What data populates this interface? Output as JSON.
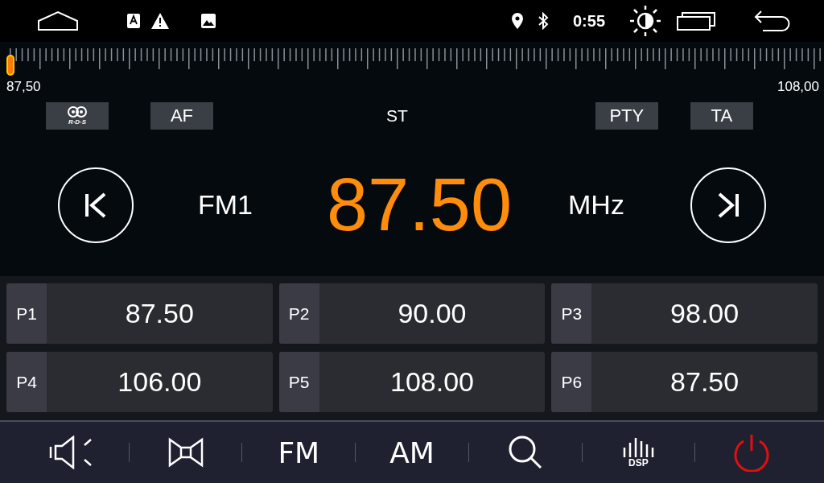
{
  "status_bar": {
    "time": "0:55"
  },
  "tuner": {
    "level": 0,
    "min_label": "87,50",
    "max_label": "108,00"
  },
  "indicators": [
    {
      "kind": "rds",
      "label": "R·D·S"
    },
    {
      "kind": "button",
      "label": "AF"
    },
    {
      "kind": "text",
      "label": "ST"
    },
    {
      "kind": "button",
      "label": "PTY"
    },
    {
      "kind": "button",
      "label": "TA"
    }
  ],
  "band": "FM1",
  "frequency": "87.50",
  "unit": "MHz",
  "presets": [
    {
      "label": "P1",
      "frequency": "87.50"
    },
    {
      "label": "P2",
      "frequency": "90.00"
    },
    {
      "label": "P3",
      "frequency": "98.00"
    },
    {
      "label": "P4",
      "frequency": "106.00"
    },
    {
      "label": "P5",
      "frequency": "108.00"
    },
    {
      "label": "P6",
      "frequency": "87.50"
    }
  ],
  "toolbar": [
    {
      "kind": "mute"
    },
    {
      "kind": "loud"
    },
    {
      "kind": "text",
      "label": "FM"
    },
    {
      "kind": "text",
      "label": "AM"
    },
    {
      "kind": "search"
    },
    {
      "kind": "dsp",
      "label": "DSP"
    },
    {
      "kind": "power"
    }
  ]
}
